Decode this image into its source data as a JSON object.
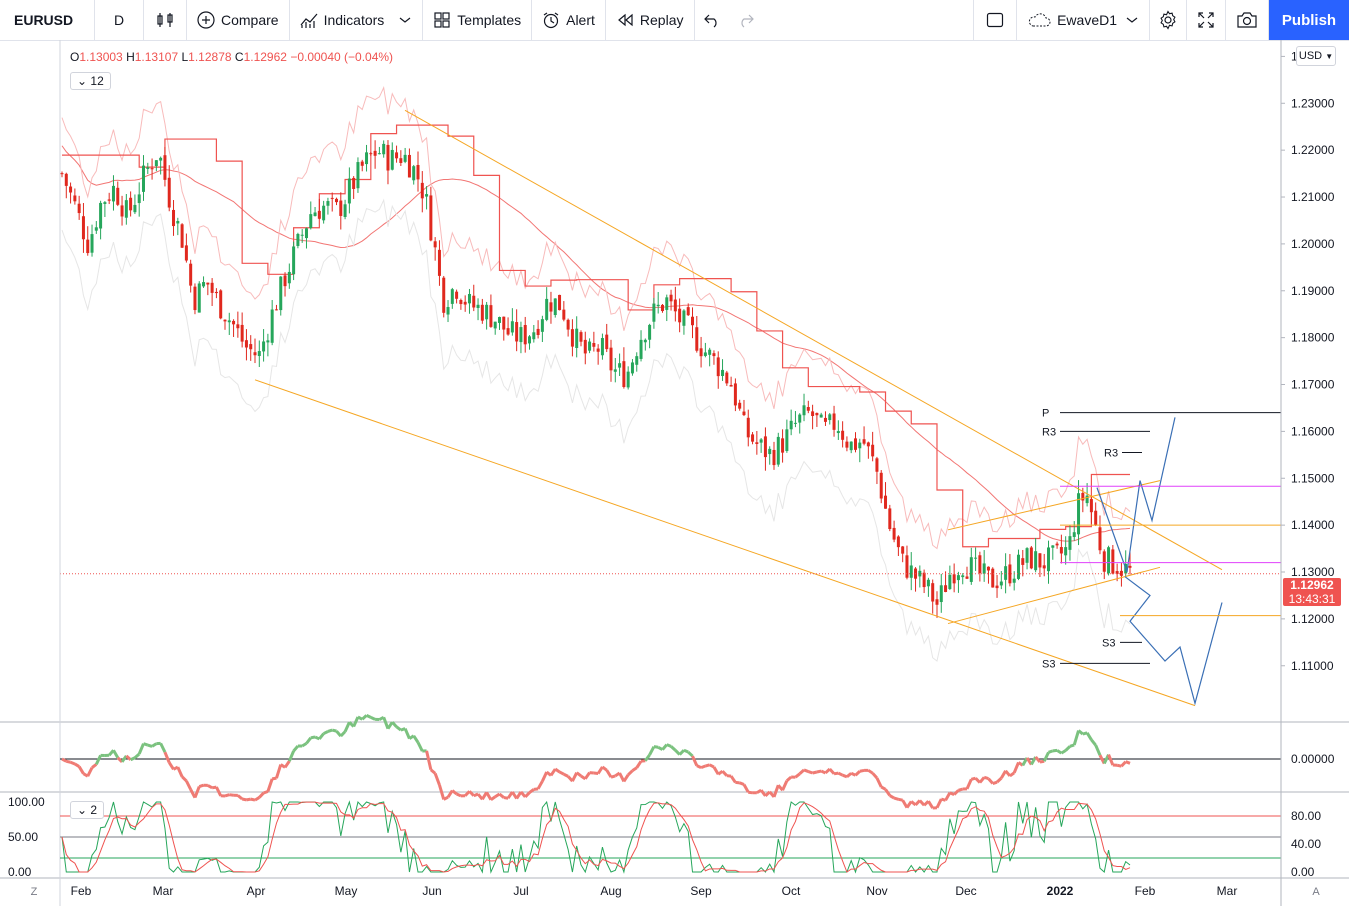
{
  "toolbar": {
    "symbol": "EURUSD",
    "interval": "D",
    "compare": "Compare",
    "indicators": "Indicators",
    "templates": "Templates",
    "alert": "Alert",
    "replay": "Replay",
    "layout_name": "EwaveD1",
    "publish": "Publish"
  },
  "legend": {
    "o_label": "O",
    "o": "1.13003",
    "h_label": "H",
    "h": "1.13107",
    "l_label": "L",
    "l": "1.12878",
    "c_label": "C",
    "c": "1.12962",
    "change": "−0.00040 (−0.04%)",
    "indicator_count": "12",
    "sub_indicator_count": "2"
  },
  "currency": "USD",
  "last_price": {
    "value": "1.12962",
    "countdown": "13:43:31"
  },
  "corner_left": "Z",
  "corner_right": "A",
  "colors": {
    "up": "#26a65b",
    "down": "#e0281e",
    "accent": "#2962ff",
    "orange": "#f5a623"
  },
  "chart_data": [
    {
      "type": "candlestick",
      "symbol": "EURUSD",
      "interval": "D",
      "x_ticks": [
        "Feb",
        "Mar",
        "Apr",
        "May",
        "Jun",
        "Jul",
        "Aug",
        "Sep",
        "Oct",
        "Nov",
        "Dec",
        "2022",
        "Feb",
        "Mar"
      ],
      "y_ticks": [
        "1.24000",
        "1.23000",
        "1.22000",
        "1.21000",
        "1.20000",
        "1.19000",
        "1.18000",
        "1.17000",
        "1.16000",
        "1.15000",
        "1.14000",
        "1.13000",
        "1.12000",
        "1.11000"
      ],
      "ylim": [
        1.098,
        1.2435
      ],
      "price_path": [
        [
          0,
          1.215
        ],
        [
          6,
          1.208
        ],
        [
          12,
          1.2
        ],
        [
          18,
          1.209
        ],
        [
          24,
          1.212
        ],
        [
          30,
          1.206
        ],
        [
          38,
          1.215
        ],
        [
          44,
          1.22
        ],
        [
          50,
          1.208
        ],
        [
          55,
          1.201
        ],
        [
          60,
          1.188
        ],
        [
          66,
          1.192
        ],
        [
          72,
          1.187
        ],
        [
          78,
          1.183
        ],
        [
          84,
          1.178
        ],
        [
          90,
          1.176
        ],
        [
          96,
          1.185
        ],
        [
          102,
          1.193
        ],
        [
          108,
          1.2
        ],
        [
          114,
          1.207
        ],
        [
          120,
          1.208
        ],
        [
          126,
          1.207
        ],
        [
          132,
          1.212
        ],
        [
          138,
          1.217
        ],
        [
          144,
          1.22
        ],
        [
          150,
          1.218
        ],
        [
          156,
          1.219
        ],
        [
          162,
          1.215
        ],
        [
          166,
          1.21
        ],
        [
          170,
          1.2
        ],
        [
          174,
          1.188
        ],
        [
          180,
          1.191
        ],
        [
          186,
          1.187
        ],
        [
          192,
          1.186
        ],
        [
          198,
          1.184
        ],
        [
          204,
          1.181
        ],
        [
          210,
          1.18
        ],
        [
          216,
          1.182
        ],
        [
          222,
          1.188
        ],
        [
          228,
          1.187
        ],
        [
          234,
          1.18
        ],
        [
          240,
          1.176
        ],
        [
          246,
          1.178
        ],
        [
          252,
          1.173
        ],
        [
          258,
          1.172
        ],
        [
          264,
          1.18
        ],
        [
          270,
          1.185
        ],
        [
          276,
          1.188
        ],
        [
          282,
          1.184
        ],
        [
          288,
          1.181
        ],
        [
          294,
          1.177
        ],
        [
          300,
          1.174
        ],
        [
          306,
          1.17
        ],
        [
          312,
          1.16
        ],
        [
          318,
          1.157
        ],
        [
          324,
          1.155
        ],
        [
          330,
          1.158
        ],
        [
          336,
          1.162
        ],
        [
          342,
          1.164
        ],
        [
          348,
          1.16
        ],
        [
          354,
          1.162
        ],
        [
          360,
          1.157
        ],
        [
          366,
          1.158
        ],
        [
          372,
          1.152
        ],
        [
          378,
          1.14
        ],
        [
          384,
          1.132
        ],
        [
          390,
          1.129
        ],
        [
          396,
          1.126
        ],
        [
          400,
          1.123
        ],
        [
          406,
          1.13
        ],
        [
          412,
          1.132
        ],
        [
          418,
          1.13
        ],
        [
          424,
          1.128
        ],
        [
          430,
          1.129
        ],
        [
          436,
          1.131
        ],
        [
          442,
          1.133
        ],
        [
          448,
          1.132
        ],
        [
          454,
          1.133
        ],
        [
          460,
          1.135
        ],
        [
          464,
          1.144
        ],
        [
          468,
          1.147
        ],
        [
          472,
          1.14
        ],
        [
          476,
          1.133
        ],
        [
          480,
          1.132
        ],
        [
          484,
          1.131
        ],
        [
          488,
          1.13
        ]
      ],
      "last_close": 1.12962,
      "horizontal_levels": [
        {
          "label": "P",
          "value": 1.164,
          "color": "#131722"
        },
        {
          "label": "R3",
          "value": 1.16,
          "color": "#131722"
        },
        {
          "label": "R3",
          "value": 1.1555,
          "color": "#131722"
        },
        {
          "label": "S3",
          "value": 1.115,
          "color": "#131722"
        },
        {
          "label": "S3",
          "value": 1.1105,
          "color": "#131722"
        },
        {
          "label": "",
          "value": 1.1483,
          "color": "#e040fb"
        },
        {
          "label": "",
          "value": 1.132,
          "color": "#e040fb"
        },
        {
          "label": "",
          "value": 1.14,
          "color": "#f5a623"
        },
        {
          "label": "",
          "value": 1.1207,
          "color": "#f5a623"
        }
      ]
    },
    {
      "type": "line",
      "name": "oscillator",
      "y_ticks": [
        "0.00000"
      ]
    },
    {
      "type": "line",
      "name": "stochastic",
      "y_ticks_left": [
        "100.00",
        "50.00",
        "0.00"
      ],
      "y_ticks_right": [
        "80.00",
        "40.00",
        "0.00"
      ]
    }
  ]
}
